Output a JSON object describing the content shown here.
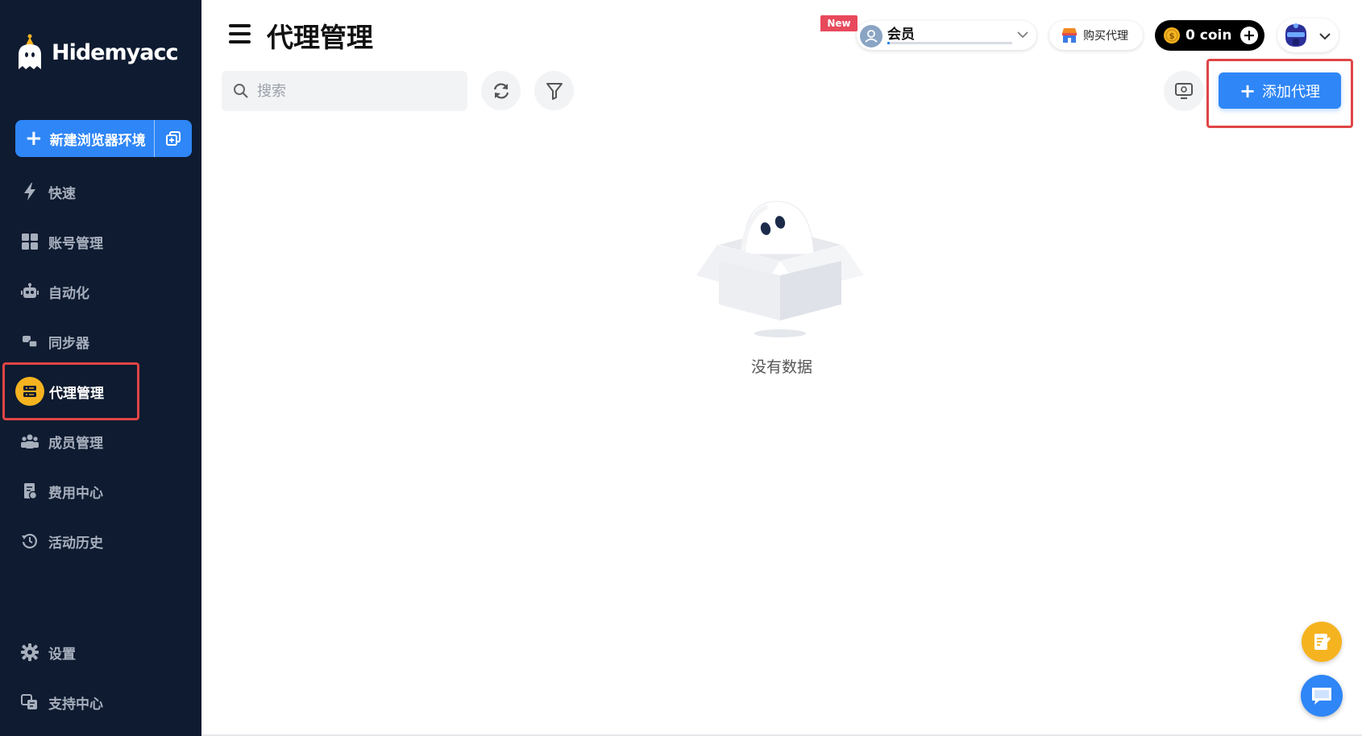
{
  "app": {
    "logo_text": "Hidemyacc"
  },
  "sidebar": {
    "new_env_label": "新建浏览器环境",
    "items": [
      {
        "label": "快速",
        "icon": "lightning-icon"
      },
      {
        "label": "账号管理",
        "icon": "grid-icon"
      },
      {
        "label": "自动化",
        "icon": "robot-icon"
      },
      {
        "label": "同步器",
        "icon": "sync-icon"
      },
      {
        "label": "代理管理",
        "icon": "server-icon",
        "active": true
      },
      {
        "label": "成员管理",
        "icon": "team-icon"
      },
      {
        "label": "费用中心",
        "icon": "billing-icon"
      },
      {
        "label": "活动历史",
        "icon": "history-icon"
      }
    ],
    "bottom_items": [
      {
        "label": "设置",
        "icon": "gear-icon"
      },
      {
        "label": "支持中心",
        "icon": "support-icon"
      }
    ]
  },
  "header": {
    "title": "代理管理",
    "new_badge": "New",
    "member_label": "会员",
    "member_progress": 0.02,
    "buy_proxy_label": "购买代理",
    "coin_label": "0 coin"
  },
  "toolbar": {
    "search_placeholder": "搜索",
    "add_proxy_label": "添加代理"
  },
  "main": {
    "empty_text": "没有数据"
  },
  "colors": {
    "sidebar_bg": "#0e1b30",
    "primary": "#2f86f6",
    "accent": "#f5b320",
    "highlight": "#e04545",
    "badge": "#e8495c"
  }
}
